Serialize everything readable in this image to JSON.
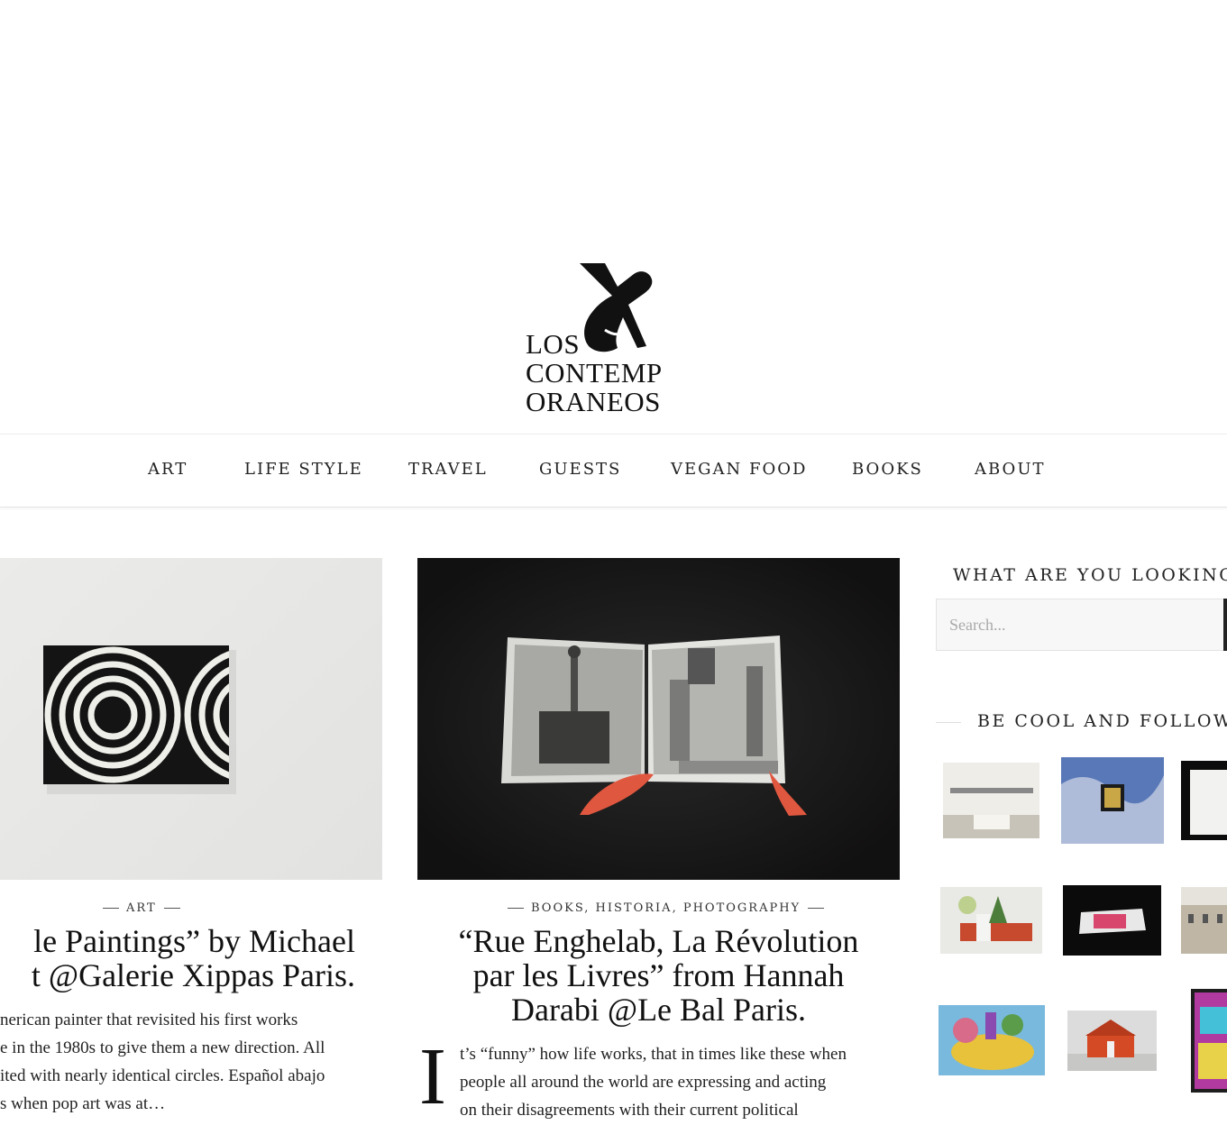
{
  "logo": {
    "lines": [
      "LOS",
      "CONTEMP",
      "ORANEOS"
    ]
  },
  "nav": {
    "items": [
      "ART",
      "LIFE STYLE",
      "TRAVEL",
      "GUESTS",
      "VEGAN FOOD",
      "BOOKS",
      "ABOUT"
    ]
  },
  "posts": [
    {
      "category": "ART",
      "title_lines": [
        "le Paintings” by Michael",
        "t @Galerie Xippas Paris."
      ],
      "excerpt_lines": [
        "nerican painter that revisited his first works",
        "e in the 1980s to give them a new direction. All",
        "ited with nearly identical circles. Español abajo",
        "s when pop art was at…"
      ]
    },
    {
      "categories": [
        "BOOKS",
        "HISTORIA",
        "PHOTOGRAPHY"
      ],
      "title_lines": [
        "“Rue Enghelab, La Révolution",
        "par les Livres” from Hannah",
        "Darabi @Le Bal Paris."
      ],
      "dropcap": "I",
      "excerpt_lines": [
        "t’s “funny” how life works, that in times like these when",
        "people all around the world are expressing and acting",
        "on their disagreements with their current political"
      ]
    }
  ],
  "sidebar": {
    "search_title": "WHAT ARE YOU LOOKING F",
    "search_placeholder": "Search...",
    "follow_title": "BE COOL AND FOLLOW U"
  },
  "colors": {
    "text": "#111111",
    "nav_border": "#e4e4e4",
    "search_bg": "#f7f7f7",
    "post2_bg": "#121111"
  },
  "icons": [
    "logo-mark-icon",
    "search-icon"
  ]
}
